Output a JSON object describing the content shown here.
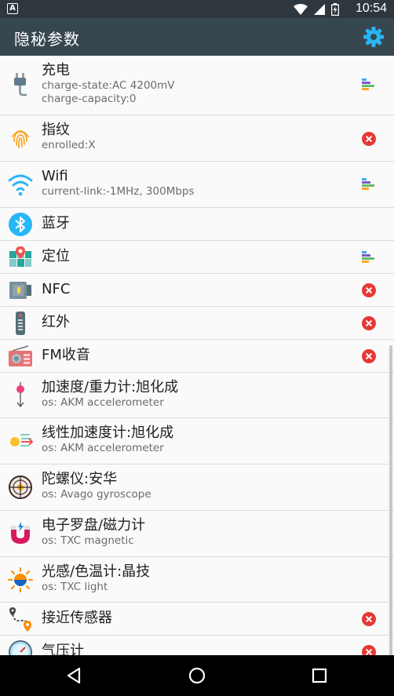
{
  "status": {
    "notification_glyph": "A",
    "time": "10:54",
    "icons": [
      "wifi-icon",
      "signal-icon",
      "battery-icon"
    ]
  },
  "app": {
    "title": "隐秘参数",
    "settings_icon": "gear-icon",
    "accent": "#29b6f6",
    "bar_color": "#37474f"
  },
  "items": [
    {
      "name": "充电",
      "sub": [
        "charge-state:AC 4200mV",
        "charge-capacity:0"
      ],
      "icon": "charger-plug-icon",
      "action": "bars"
    },
    {
      "name": "指纹",
      "sub": [
        "enrolled:X"
      ],
      "icon": "fingerprint-icon",
      "action": "close"
    },
    {
      "name": "Wifi",
      "sub": [
        "current-link:-1MHz, 300Mbps"
      ],
      "icon": "wifi-icon",
      "action": "bars"
    },
    {
      "name": "蓝牙",
      "sub": [],
      "icon": "bluetooth-icon",
      "action": "none"
    },
    {
      "name": "定位",
      "sub": [],
      "icon": "map-location-icon",
      "action": "bars"
    },
    {
      "name": "NFC",
      "sub": [],
      "icon": "nfc-icon",
      "action": "close"
    },
    {
      "name": "红外",
      "sub": [],
      "icon": "remote-control-icon",
      "action": "close"
    },
    {
      "name": "FM收音",
      "sub": [],
      "icon": "radio-icon",
      "action": "close"
    },
    {
      "name": "加速度/重力计:旭化成",
      "sub": [
        "os: AKM accelerometer"
      ],
      "icon": "accelerometer-icon",
      "action": "none"
    },
    {
      "name": "线性加速度计:旭化成",
      "sub": [
        "os: AKM accelerometer"
      ],
      "icon": "linear-acceleration-icon",
      "action": "none"
    },
    {
      "name": "陀螺仪:安华",
      "sub": [
        "os: Avago gyroscope"
      ],
      "icon": "gyroscope-icon",
      "action": "none"
    },
    {
      "name": "电子罗盘/磁力计",
      "sub": [
        "os: TXC magnetic"
      ],
      "icon": "magnet-icon",
      "action": "none"
    },
    {
      "name": "光感/色温计:晶技",
      "sub": [
        "os: TXC light"
      ],
      "icon": "light-sensor-icon",
      "action": "none"
    },
    {
      "name": "接近传感器",
      "sub": [],
      "icon": "proximity-route-icon",
      "action": "close"
    },
    {
      "name": "气压计",
      "sub": [],
      "icon": "barometer-icon",
      "action": "close"
    }
  ],
  "nav": {
    "back_icon": "back-icon",
    "home_icon": "home-icon",
    "recents_icon": "recents-icon"
  }
}
